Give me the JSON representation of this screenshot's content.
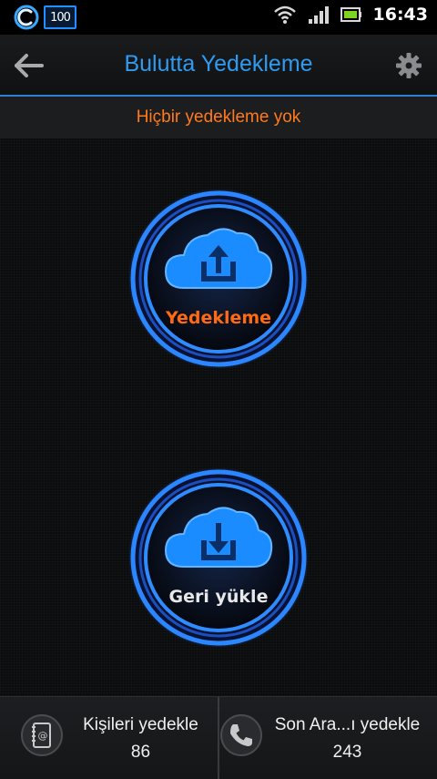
{
  "status_bar": {
    "battery_percent": "100",
    "time": "16:43",
    "icons": [
      "app-logo-icon",
      "wifi-icon",
      "signal-icon",
      "battery-icon"
    ]
  },
  "header": {
    "title": "Bulutta Yedekleme",
    "back_icon": "back-arrow-icon",
    "settings_icon": "gear-icon"
  },
  "status_message": "Hiçbir yedekleme yok",
  "actions": {
    "backup": {
      "label": "Yedekleme",
      "icon": "cloud-upload-icon"
    },
    "restore": {
      "label": "Geri yükle",
      "icon": "cloud-download-icon"
    }
  },
  "bottom_bar": {
    "contacts": {
      "label": "Kişileri yedekle",
      "count": "86",
      "icon": "address-book-icon"
    },
    "calls": {
      "label": "Son Ara...ı yedekle",
      "count": "243",
      "icon": "phone-icon"
    }
  },
  "colors": {
    "accent_blue": "#2f9bf0",
    "ring_blue": "#1e6fff",
    "orange": "#ff6a10",
    "background": "#0b0c0e"
  }
}
